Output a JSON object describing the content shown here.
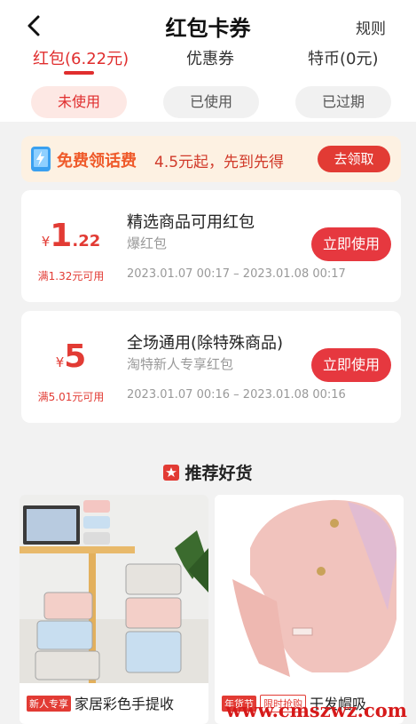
{
  "header": {
    "title": "红包卡券",
    "rules": "规则"
  },
  "tabs": [
    {
      "label": "红包(6.22元)",
      "active": true
    },
    {
      "label": "优惠券",
      "active": false
    },
    {
      "label": "特币(0元)",
      "active": false
    }
  ],
  "filters": [
    {
      "label": "未使用",
      "active": true
    },
    {
      "label": "已使用",
      "active": false
    },
    {
      "label": "已过期",
      "active": false
    }
  ],
  "promo": {
    "brand": "免费领话费",
    "text": "4.5元起，先到先得",
    "button": "去领取"
  },
  "coupons": [
    {
      "yen": "¥",
      "amount_int": "1",
      "amount_dec": ".22",
      "condition": "满1.32元可用",
      "title": "精选商品可用红包",
      "subtitle": "爆红包",
      "dates": "2023.01.07 00:17 – 2023.01.08 00:17",
      "button": "立即使用"
    },
    {
      "yen": "¥",
      "amount_int": "5",
      "amount_dec": "",
      "condition": "满5.01元可用",
      "title": "全场通用(除特殊商品)",
      "subtitle": "淘特新人专享红包",
      "dates": "2023.01.07 00:16 – 2023.01.08 00:16",
      "button": "立即使用"
    }
  ],
  "recommend": {
    "title": "推荐好货"
  },
  "products": [
    {
      "tags": [
        "新人专享"
      ],
      "name": "家居彩色手提收"
    },
    {
      "tags": [
        "年货节",
        "限时抢购"
      ],
      "name": "干发帽吸"
    }
  ],
  "watermark": "www.cmszwz.com",
  "colors": {
    "accent": "#e23b34",
    "promo_bg": "#fdf1e2",
    "filter_active_bg": "#fde8e4"
  },
  "icons": [
    "back-arrow-icon",
    "phone-bolt-icon",
    "star-badge-icon"
  ]
}
